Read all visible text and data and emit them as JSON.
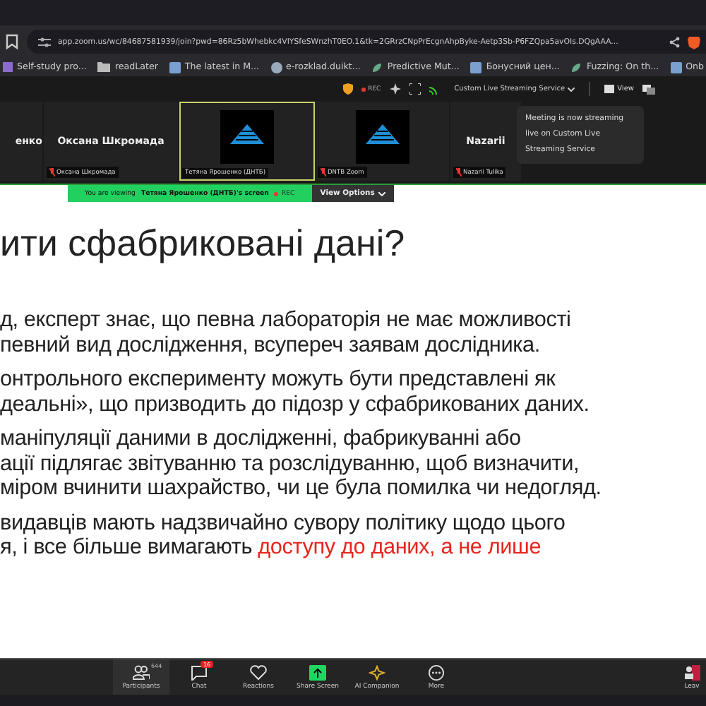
{
  "browser": {
    "url": "app.zoom.us/wc/84687581939/join?pwd=86Rz5bWhebkc4VIYSfeSWnzhT0EO.1&tk=2GRrzCNpPrEcgnAhpByke-Aetp3Sb-P6FZQpa5avOIs.DQgAAA...",
    "bookmarks": [
      {
        "label": "Self-study pro...",
        "kind": "apps"
      },
      {
        "label": "readLater",
        "kind": "folder"
      },
      {
        "label": "The latest in M...",
        "kind": "page"
      },
      {
        "label": "e-rozklad.duikt...",
        "kind": "globe"
      },
      {
        "label": "Predictive Mut...",
        "kind": "leaf"
      },
      {
        "label": "Бонусний цен...",
        "kind": "page"
      },
      {
        "label": "Fuzzing: On th...",
        "kind": "leaf"
      },
      {
        "label": "Onb",
        "kind": "page"
      }
    ]
  },
  "meeting_bar": {
    "rec": "REC",
    "streaming": "Custom Live Streaming Service",
    "view": "View"
  },
  "participants": [
    {
      "name": "енко",
      "kind": "name"
    },
    {
      "name": "Оксана Шкромада",
      "label": "Оксана Шкромада",
      "muted": true,
      "kind": "name"
    },
    {
      "label": "Тетяна Ярошенко (ДНТБ)",
      "muted": false,
      "kind": "logo",
      "selected": true
    },
    {
      "label": "DNTB Zoom",
      "muted": true,
      "kind": "logo",
      "selected": false
    },
    {
      "name": "Nazarii",
      "label": "Nazarii Tulika",
      "muted": true,
      "kind": "name"
    }
  ],
  "tooltip": "Meeting is now streaming live on Custom Live Streaming Service",
  "share_banner": {
    "prefix": "You are viewing",
    "name": "Тетяна Ярошенко (ДНТБ)'s screen",
    "rec": "REC",
    "view_options": "View Options"
  },
  "slide": {
    "title": "ити сфабриковані дані?",
    "paragraphs": [
      [
        {
          "text": "д, експерт  знає, що певна лабораторія не має можливості"
        },
        {
          "text": " певний вид дослідження, всупереч заявам дослідника."
        }
      ],
      [
        {
          "text": "онтрольного експерименту можуть бути представлені як"
        },
        {
          "text": "деальні», що призводить до підозр у сфабрикованих даних."
        }
      ],
      [
        {
          "text": "маніпуляції даними в дослідженні, фабрикуванні або"
        },
        {
          "text": "ації підлягає звітуванню та розслідуванню, щоб визначити,"
        },
        {
          "text": "міром вчинити шахрайство, чи це була помилка чи недогляд."
        }
      ],
      [
        {
          "text": "видавців мають надзвичайно сувору політику щодо цього"
        },
        {
          "text": "я, і все більше вимагають ",
          "accent": "доступу до даних, а не лише"
        }
      ]
    ]
  },
  "toolbar": [
    {
      "label": "Participants",
      "kind": "participants",
      "badge": "644"
    },
    {
      "label": "Chat",
      "kind": "chat",
      "badge": "16"
    },
    {
      "label": "Reactions",
      "kind": "reactions"
    },
    {
      "label": "Share Screen",
      "kind": "share"
    },
    {
      "label": "AI Companion",
      "kind": "ai"
    },
    {
      "label": "More",
      "kind": "more"
    },
    {
      "label": "Leav",
      "kind": "leave"
    }
  ]
}
